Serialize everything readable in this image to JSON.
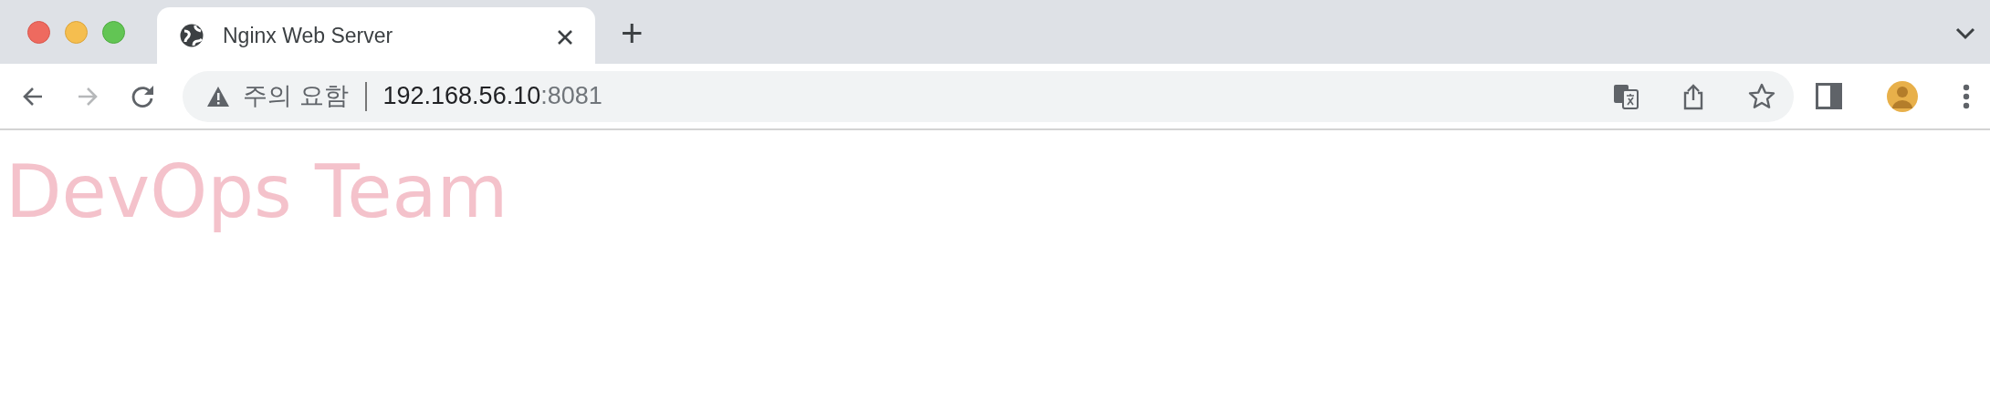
{
  "tabs": [
    {
      "title": "Nginx Web Server",
      "selected": true
    }
  ],
  "new_tab": "+",
  "nav_buttons": [
    {
      "kind": "back",
      "disabled": false
    },
    {
      "kind": "forward",
      "disabled": true
    },
    {
      "kind": "reload",
      "disabled": false
    }
  ],
  "address_bar": {
    "security_label": "주의 요함",
    "host": "192.168.56.10",
    "port": ":8081"
  },
  "page": {
    "heading": "DevOps Team"
  }
}
